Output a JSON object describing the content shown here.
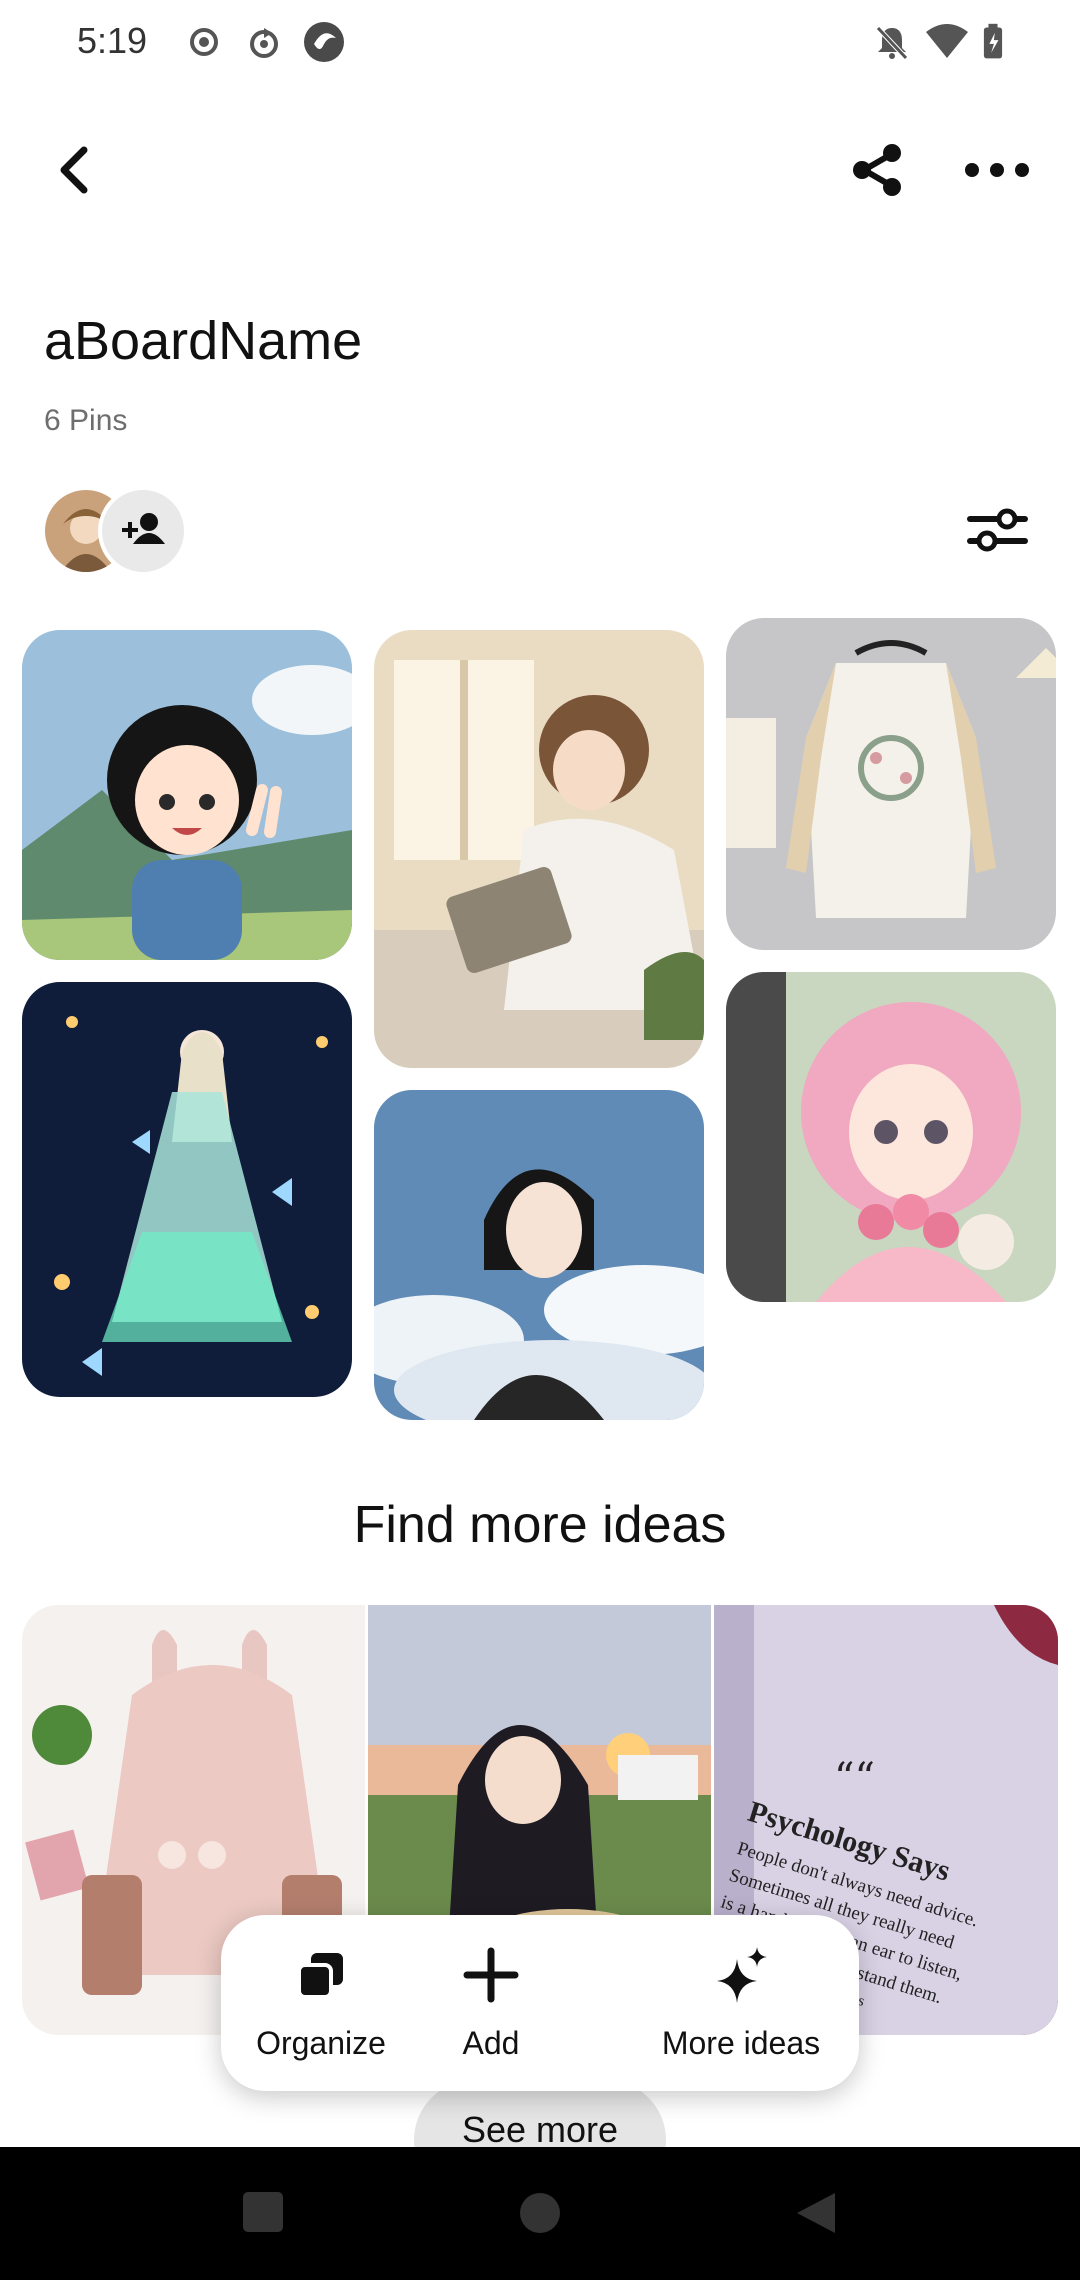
{
  "status_bar": {
    "time": "5:19",
    "left_icons": [
      "record-icon",
      "sync-icon",
      "app-icon"
    ],
    "right_icons": [
      "bell-off-icon",
      "wifi-icon",
      "battery-charging-icon"
    ]
  },
  "header": {
    "back_icon": "chevron-left-icon",
    "share_icon": "share-icon",
    "more_icon": "more-dots-icon"
  },
  "board": {
    "title": "aBoardName",
    "pin_count": "6 Pins"
  },
  "pins": [
    {
      "desc": "anime girl peace sign",
      "colors": [
        "#8fb6d8",
        "#3d6a96"
      ]
    },
    {
      "desc": "girl reading by window",
      "colors": [
        "#efe2c8",
        "#b59a78"
      ]
    },
    {
      "desc": "white hoodie dress",
      "colors": [
        "#c9c9cb",
        "#f3efe8"
      ]
    },
    {
      "desc": "princess with butterflies",
      "colors": [
        "#0d1a36",
        "#5fd9c0"
      ]
    },
    {
      "desc": "girl with short hair sky",
      "colors": [
        "#5c88b5",
        "#e8eef4"
      ]
    },
    {
      "desc": "pink haired girl with flowers",
      "colors": [
        "#cfd9c2",
        "#f0a8bf"
      ]
    }
  ],
  "find_more": {
    "title": "Find more ideas",
    "ideas": [
      {
        "desc": "pink bunny hoodie",
        "colors": [
          "#f4f0ee",
          "#e8c7c2"
        ]
      },
      {
        "desc": "girl with guitar at sunset",
        "colors": [
          "#bfc6d6",
          "#7e6bb5"
        ]
      },
      {
        "desc": "book page quote",
        "colors": [
          "#7b1f35",
          "#d8d0e4"
        ]
      }
    ],
    "book_quote_mark": "““",
    "book_heading": "Psychology Says",
    "book_lines": [
      "People don't always need advice.",
      "Sometimes all they really need",
      "is a hand to hold, an ear to listen,",
      "and a heart to understand them."
    ],
    "book_footer": "idefeelings"
  },
  "toolbar": {
    "organize_label": "Organize",
    "add_label": "Add",
    "more_ideas_label": "More ideas"
  },
  "see_more_label": "See more",
  "nav_bar": [
    "recents-square-icon",
    "home-circle-icon",
    "back-triangle-icon"
  ]
}
